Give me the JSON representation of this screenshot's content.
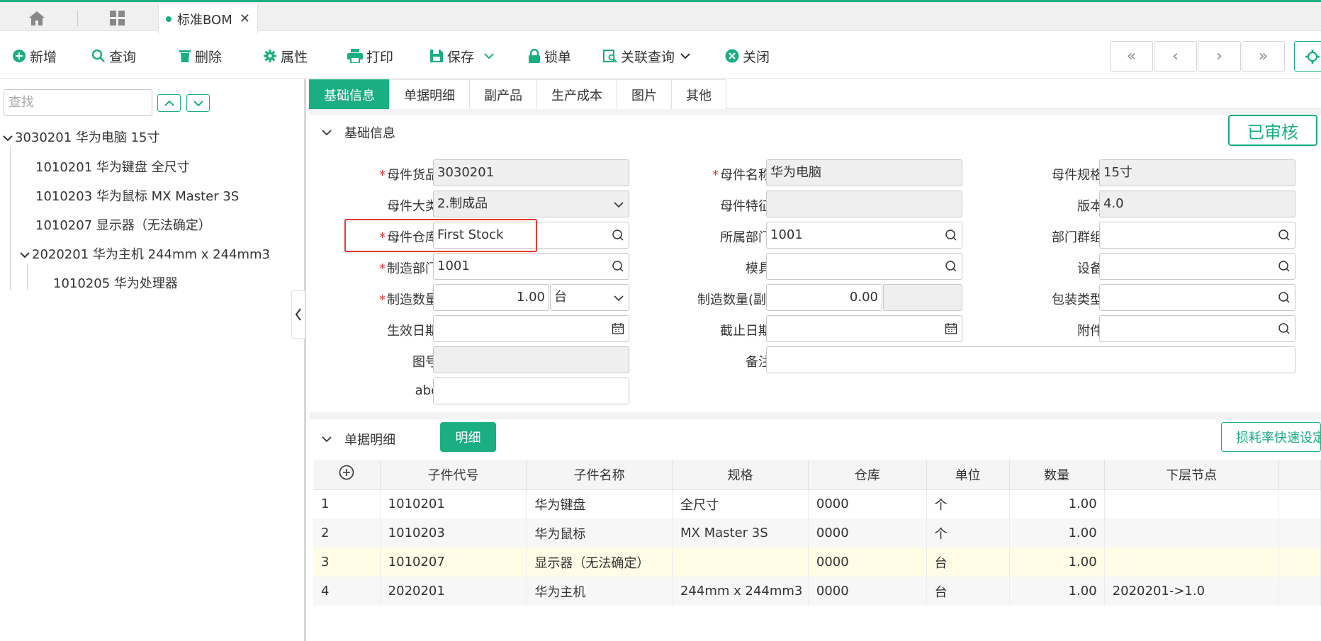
{
  "app": {
    "tab_label": "标准BOM"
  },
  "toolbar": {
    "add": "新增",
    "query": "查询",
    "delete": "删除",
    "props": "属性",
    "print": "打印",
    "save": "保存",
    "lock": "锁单",
    "related": "关联查询",
    "close": "关闭"
  },
  "left": {
    "search_placeholder": "查找",
    "tree": [
      {
        "label": "3030201 华为电脑 15寸"
      },
      {
        "label": "1010201 华为键盘 全尺寸"
      },
      {
        "label": "1010203 华为鼠标 MX Master 3S"
      },
      {
        "label": "1010207 显示器（无法确定）"
      },
      {
        "label": "2020201 华为主机 244mm x 244mm3"
      },
      {
        "label": "1010205 华为处理器"
      }
    ]
  },
  "tabs": [
    "基础信息",
    "单据明细",
    "副产品",
    "生产成本",
    "图片",
    "其他"
  ],
  "basic": {
    "section_title": "基础信息",
    "status": "已审核",
    "labels": {
      "parent_item": "母件货品",
      "parent_name": "母件名称",
      "parent_spec": "母件规格",
      "category": "母件大类",
      "feature": "母件特征",
      "version": "版本",
      "warehouse": "母件仓库",
      "dept": "所属部门",
      "dept_group": "部门群组",
      "mfg_dept": "制造部门",
      "mold": "模具",
      "equipment": "设备",
      "mfg_qty": "制造数量",
      "mfg_qty_sub": "制造数量(副)",
      "pack_type": "包装类型",
      "eff_date": "生效日期",
      "end_date": "截止日期",
      "attachment": "附件",
      "drawing_no": "图号",
      "remark": "备注",
      "abc": "abc"
    },
    "values": {
      "parent_item": "3030201",
      "parent_name": "华为电脑",
      "parent_spec": "15寸",
      "category": "2.制成品",
      "version": "4.0",
      "warehouse": "First Stock",
      "dept": "1001",
      "mfg_dept": "1001",
      "mfg_qty": "1.00",
      "unit": "台",
      "mfg_qty_sub": "0.00"
    }
  },
  "detail": {
    "section_title": "单据明细",
    "detail_btn": "明细",
    "loss_btn": "损耗率快速设定",
    "columns": [
      "子件代号",
      "子件名称",
      "规格",
      "仓库",
      "单位",
      "数量",
      "下层节点"
    ],
    "rows": [
      {
        "idx": "1",
        "code": "1010201",
        "name": "华为键盘",
        "spec": "全尺寸",
        "wh": "0000",
        "unit": "个",
        "qty": "1.00",
        "node": ""
      },
      {
        "idx": "2",
        "code": "1010203",
        "name": "华为鼠标",
        "spec": "MX Master 3S",
        "wh": "0000",
        "unit": "个",
        "qty": "1.00",
        "node": ""
      },
      {
        "idx": "3",
        "code": "1010207",
        "name": "显示器（无法确定）",
        "spec": "",
        "wh": "0000",
        "unit": "台",
        "qty": "1.00",
        "node": ""
      },
      {
        "idx": "4",
        "code": "2020201",
        "name": "华为主机",
        "spec": "244mm x 244mm3",
        "wh": "0000",
        "unit": "台",
        "qty": "1.00",
        "node": "2020201->1.0"
      }
    ]
  },
  "colors": {
    "accent": "#1aae82",
    "required": "#e23b3b",
    "highlight": "#e53935"
  }
}
